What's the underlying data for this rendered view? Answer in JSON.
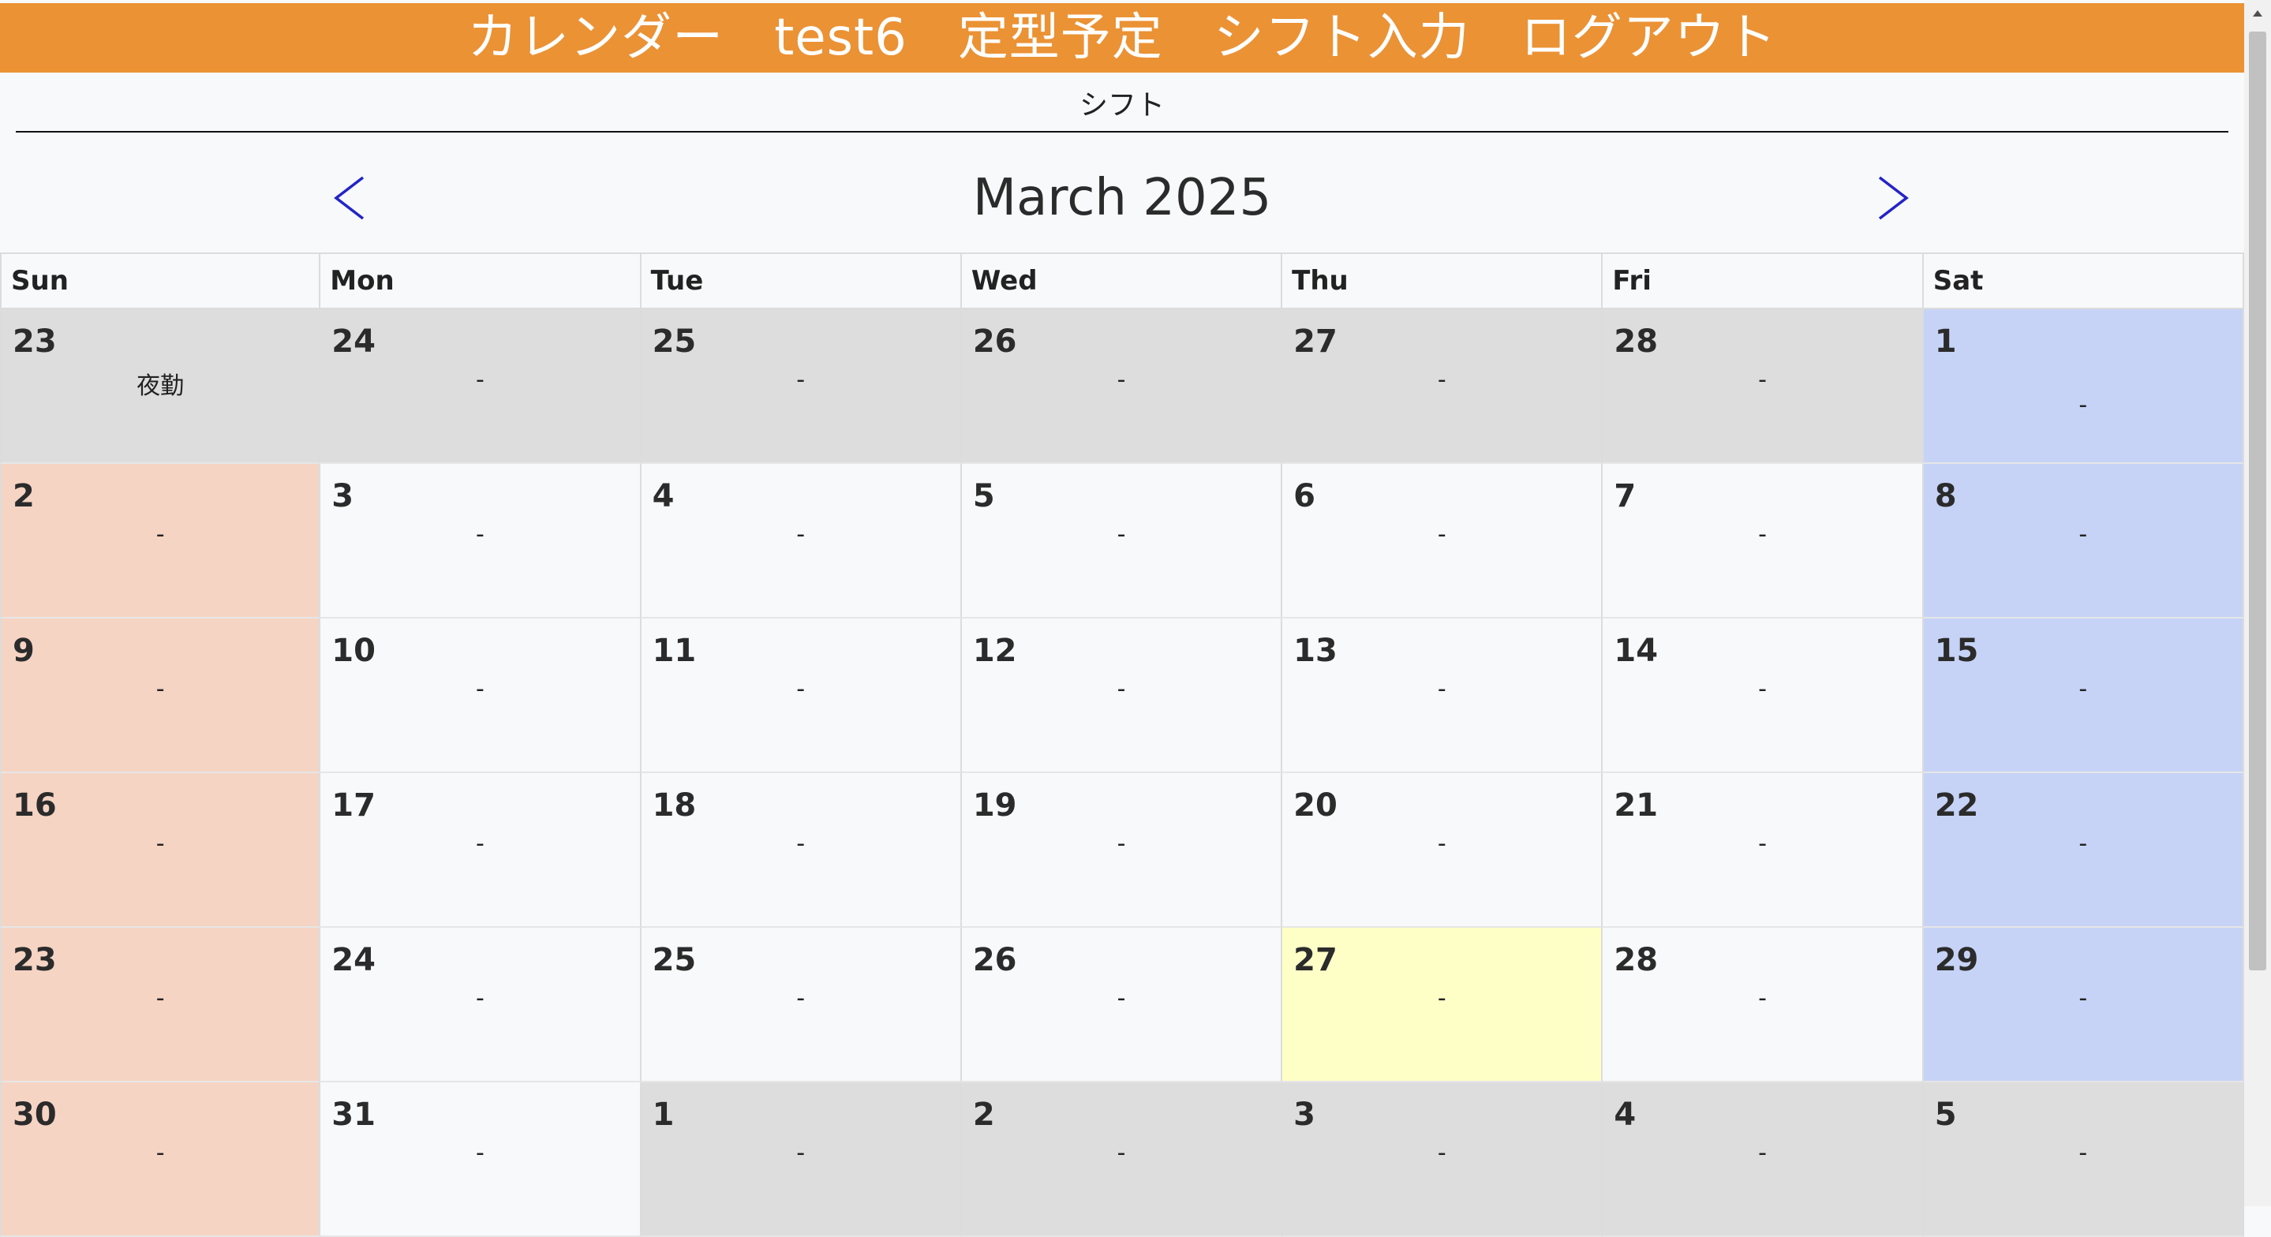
{
  "nav": {
    "items": [
      {
        "label": "カレンダー"
      },
      {
        "label": "test6"
      },
      {
        "label": "定型予定"
      },
      {
        "label": "シフト入力"
      },
      {
        "label": "ログアウト"
      }
    ],
    "color": "#eb9235"
  },
  "page": {
    "subtitle": "シフト"
  },
  "calendar": {
    "title": "March 2025",
    "prev_icon": "chevron-left-icon",
    "next_icon": "chevron-right-icon",
    "weekdays": [
      "Sun",
      "Mon",
      "Tue",
      "Wed",
      "Thu",
      "Fri",
      "Sat"
    ],
    "weeks": [
      [
        {
          "day": "23",
          "shift": "夜勤",
          "type": "other"
        },
        {
          "day": "24",
          "shift": "-",
          "type": "other"
        },
        {
          "day": "25",
          "shift": "-",
          "type": "other"
        },
        {
          "day": "26",
          "shift": "-",
          "type": "other"
        },
        {
          "day": "27",
          "shift": "-",
          "type": "other"
        },
        {
          "day": "28",
          "shift": "-",
          "type": "other"
        },
        {
          "day": "1",
          "shift": "-",
          "type": "sat"
        }
      ],
      [
        {
          "day": "2",
          "shift": "-",
          "type": "sun"
        },
        {
          "day": "3",
          "shift": "-",
          "type": "normal"
        },
        {
          "day": "4",
          "shift": "-",
          "type": "normal"
        },
        {
          "day": "5",
          "shift": "-",
          "type": "normal"
        },
        {
          "day": "6",
          "shift": "-",
          "type": "normal"
        },
        {
          "day": "7",
          "shift": "-",
          "type": "normal"
        },
        {
          "day": "8",
          "shift": "-",
          "type": "sat"
        }
      ],
      [
        {
          "day": "9",
          "shift": "-",
          "type": "sun"
        },
        {
          "day": "10",
          "shift": "-",
          "type": "normal"
        },
        {
          "day": "11",
          "shift": "-",
          "type": "normal"
        },
        {
          "day": "12",
          "shift": "-",
          "type": "normal"
        },
        {
          "day": "13",
          "shift": "-",
          "type": "normal"
        },
        {
          "day": "14",
          "shift": "-",
          "type": "normal"
        },
        {
          "day": "15",
          "shift": "-",
          "type": "sat"
        }
      ],
      [
        {
          "day": "16",
          "shift": "-",
          "type": "sun"
        },
        {
          "day": "17",
          "shift": "-",
          "type": "normal"
        },
        {
          "day": "18",
          "shift": "-",
          "type": "normal"
        },
        {
          "day": "19",
          "shift": "-",
          "type": "normal"
        },
        {
          "day": "20",
          "shift": "-",
          "type": "normal"
        },
        {
          "day": "21",
          "shift": "-",
          "type": "normal"
        },
        {
          "day": "22",
          "shift": "-",
          "type": "sat"
        }
      ],
      [
        {
          "day": "23",
          "shift": "-",
          "type": "sun"
        },
        {
          "day": "24",
          "shift": "-",
          "type": "normal"
        },
        {
          "day": "25",
          "shift": "-",
          "type": "normal"
        },
        {
          "day": "26",
          "shift": "-",
          "type": "normal"
        },
        {
          "day": "27",
          "shift": "-",
          "type": "today"
        },
        {
          "day": "28",
          "shift": "-",
          "type": "normal"
        },
        {
          "day": "29",
          "shift": "-",
          "type": "sat"
        }
      ],
      [
        {
          "day": "30",
          "shift": "-",
          "type": "sun"
        },
        {
          "day": "31",
          "shift": "-",
          "type": "normal"
        },
        {
          "day": "1",
          "shift": "-",
          "type": "other"
        },
        {
          "day": "2",
          "shift": "-",
          "type": "other"
        },
        {
          "day": "3",
          "shift": "-",
          "type": "other"
        },
        {
          "day": "4",
          "shift": "-",
          "type": "other"
        },
        {
          "day": "5",
          "shift": "-",
          "type": "other"
        }
      ]
    ],
    "colors": {
      "other": "#dddddd",
      "sun": "#f5d4c4",
      "sat": "#c6d3f6",
      "today": "#feffc7",
      "arrow": "#2323c8"
    }
  }
}
